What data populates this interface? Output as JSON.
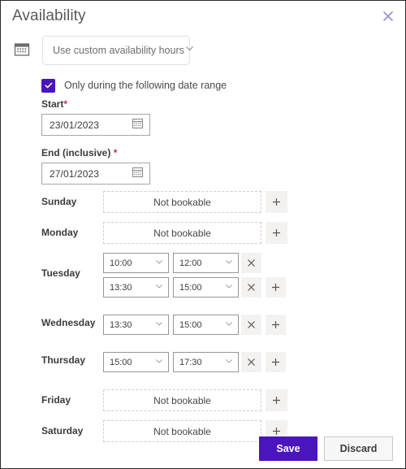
{
  "dialog": {
    "title": "Availability",
    "close_icon": "close-icon"
  },
  "availability_type": {
    "icon": "calendar-icon",
    "selected": "Use custom availability hours",
    "chevron": "chevron-down-icon"
  },
  "date_range": {
    "checkbox_checked": true,
    "checkbox_label": "Only during the following date range",
    "start": {
      "label": "Start",
      "required_marker": "*",
      "value": "23/01/2023",
      "icon": "calendar-picker-icon"
    },
    "end": {
      "label": "End (inclusive)",
      "required_marker": "*",
      "value": "27/01/2023",
      "icon": "calendar-picker-icon"
    }
  },
  "labels": {
    "not_bookable": "Not bookable",
    "add_icon": "plus-icon",
    "remove_icon": "close-small-icon"
  },
  "days": [
    {
      "name": "Sunday",
      "bookable": false,
      "slots": []
    },
    {
      "name": "Monday",
      "bookable": false,
      "slots": []
    },
    {
      "name": "Tuesday",
      "bookable": true,
      "slots": [
        {
          "start": "10:00",
          "end": "12:00"
        },
        {
          "start": "13:30",
          "end": "15:00"
        }
      ]
    },
    {
      "name": "Wednesday",
      "bookable": true,
      "slots": [
        {
          "start": "13:30",
          "end": "15:00"
        }
      ]
    },
    {
      "name": "Thursday",
      "bookable": true,
      "slots": [
        {
          "start": "15:00",
          "end": "17:30"
        }
      ]
    },
    {
      "name": "Friday",
      "bookable": false,
      "slots": []
    },
    {
      "name": "Saturday",
      "bookable": false,
      "slots": []
    }
  ],
  "footer": {
    "save_label": "Save",
    "discard_label": "Discard"
  },
  "colors": {
    "accent": "#4b15bd",
    "close_icon": "#9b8bdb",
    "required": "#c4314b",
    "button_face": "#f3f2f1"
  }
}
